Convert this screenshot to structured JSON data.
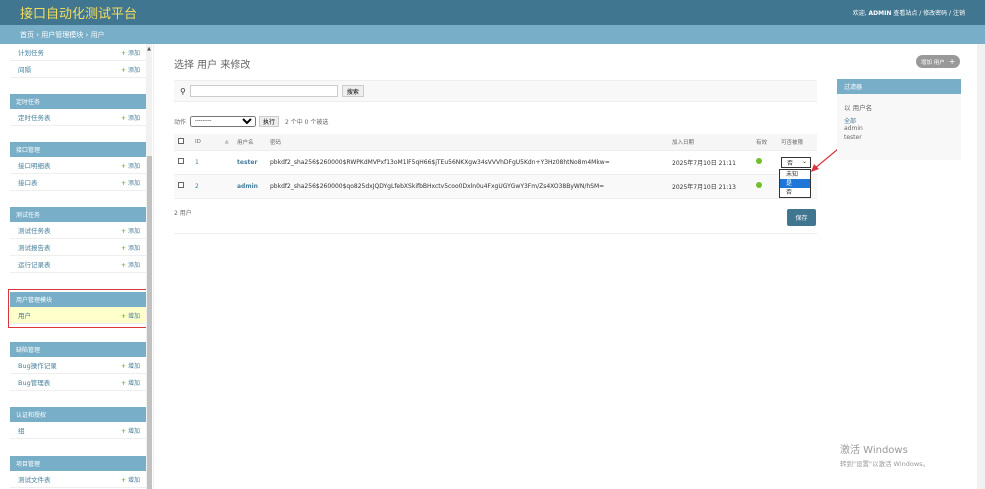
{
  "header": {
    "brand": "接口自动化测试平台",
    "welcome": "欢迎,",
    "username": "ADMIN",
    "links": "查看站点 / 修改密码 / 注销"
  },
  "breadcrumbs": {
    "home": "首页",
    "sep1": "›",
    "module": "用户管理模块",
    "sep2": "›",
    "current": "用户"
  },
  "sidebar": {
    "top_rows": [
      {
        "name": "计划任务",
        "add": "添加"
      },
      {
        "name": "间隔",
        "add": "添加"
      }
    ],
    "modules": [
      {
        "caption": "定时任务",
        "rows": [
          {
            "name": "定时任务表",
            "add": "添加"
          }
        ]
      },
      {
        "caption": "接口管理",
        "rows": [
          {
            "name": "接口明细表",
            "add": "添加"
          },
          {
            "name": "接口表",
            "add": "添加"
          }
        ]
      },
      {
        "caption": "测试任务",
        "rows": [
          {
            "name": "测试任务表",
            "add": "添加"
          },
          {
            "name": "测试报告表",
            "add": "添加"
          },
          {
            "name": "运行记录表",
            "add": "添加"
          }
        ]
      },
      {
        "caption": "用户管理模块",
        "rows": [
          {
            "name": "用户",
            "add": "增加"
          }
        ]
      },
      {
        "caption": "缺陷管理",
        "rows": [
          {
            "name": "Bug操作记录",
            "add": "增加"
          },
          {
            "name": "Bug管理表",
            "add": "增加"
          }
        ]
      },
      {
        "caption": "认证和授权",
        "rows": [
          {
            "name": "组",
            "add": "增加"
          }
        ]
      },
      {
        "caption": "项目管理",
        "rows": [
          {
            "name": "测试文件表",
            "add": "增加"
          }
        ]
      }
    ]
  },
  "main": {
    "title": "选择 用户 来修改",
    "add_button": "增加 用户",
    "search_button": "搜索",
    "search_value": "",
    "actions_label": "动作",
    "actions_selected": "---------",
    "go_button": "执行",
    "selection_count": "2 个中 0 个被选",
    "columns": [
      "ID",
      "用户名",
      "密码",
      "加入日期",
      "有效",
      "可否被限"
    ],
    "rows": [
      {
        "id": "1",
        "username": "tester",
        "password": "pbkdf2_sha256$260000$RWPKdMVPxf13oM1lF5qH66$jTEu56NKXgw34sVVVhDFgU5Kdn+Y3Hz08htNo8m4Mkw=",
        "date": "2025年7月10日 21:11",
        "select": "否"
      },
      {
        "id": "2",
        "username": "admin",
        "password": "pbkdf2_sha256$260000$qo825dxJQDYgLfebXSkifbBHxctv5coo0Dxln0u4FxgUGYGwY3Fm/Zs4XO38ByWN/hSM=",
        "date": "2025年7月10日 21:13",
        "select": ""
      }
    ],
    "dropdown_options": [
      "未知",
      "是",
      "否"
    ],
    "dropdown_highlight": "是",
    "footer_count": "2 用户",
    "save_button": "保存"
  },
  "filter": {
    "caption": "过滤器",
    "heading": "以 用户名",
    "options": [
      "全部",
      "admin",
      "tester"
    ]
  },
  "watermark": {
    "line1": "激活 Windows",
    "line2": "转到\"设置\"以激活 Windows。"
  },
  "colors": {
    "header": "#417690",
    "accent": "#79aec8",
    "brand": "#f5dd5d",
    "add": "#70bf2b",
    "highlight": "#1e76d6",
    "callout": "#d9363e"
  }
}
